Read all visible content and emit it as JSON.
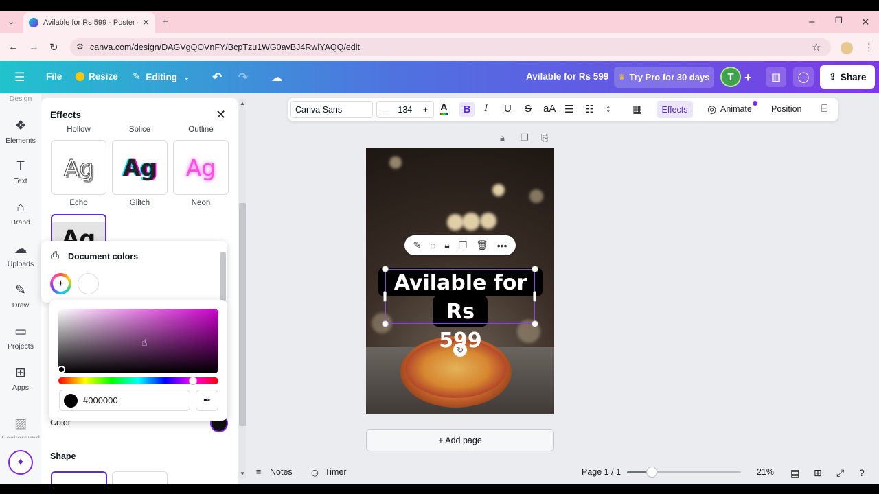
{
  "browser": {
    "tab_title": "Avilable for Rs 599 - Poster - Ca",
    "url": "canva.com/design/DAGVgQOVnFY/BcpTzu1WG0avBJ4RwlYAQQ/edit"
  },
  "header": {
    "file": "File",
    "resize": "Resize",
    "editing": "Editing",
    "design_title": "Avilable for Rs 599",
    "try_pro": "Try Pro for 30 days",
    "avatar_initial": "T",
    "share": "Share"
  },
  "sidebar": {
    "cut_top": "Design",
    "items": [
      {
        "label": "Elements"
      },
      {
        "label": "Text"
      },
      {
        "label": "Brand"
      },
      {
        "label": "Uploads"
      },
      {
        "label": "Draw"
      },
      {
        "label": "Projects"
      },
      {
        "label": "Apps"
      }
    ],
    "cut_bottom": "Background"
  },
  "effects_panel": {
    "title": "Effects",
    "cut_labels": [
      "Hollow",
      "Splice",
      "Outline"
    ],
    "styles": [
      {
        "sample": "Ag",
        "label": "Echo"
      },
      {
        "sample": "Ag",
        "label": "Glitch"
      },
      {
        "sample": "Ag",
        "label": "Neon"
      }
    ],
    "selected_sample": "Ag",
    "color_label": "Color",
    "shape_label": "Shape"
  },
  "color_popover": {
    "title": "Document colors",
    "add_symbol": "+",
    "hex_value": "#000000",
    "hue_position": 0.82
  },
  "text_toolbar": {
    "font": "Canva Sans",
    "size": "134",
    "minus": "–",
    "plus": "+",
    "effects": "Effects",
    "animate": "Animate",
    "position": "Position"
  },
  "canvas": {
    "title_line1": "Avilable for Rs",
    "title_line2": "599",
    "add_page": "+ Add page"
  },
  "footer": {
    "notes": "Notes",
    "timer": "Timer",
    "page": "Page 1 / 1",
    "zoom": "21%"
  },
  "colors": {
    "accent": "#7d2ae8",
    "header_start": "#21c3cd",
    "header_end": "#7b3ae6",
    "tabbar": "#f9d2dc"
  }
}
